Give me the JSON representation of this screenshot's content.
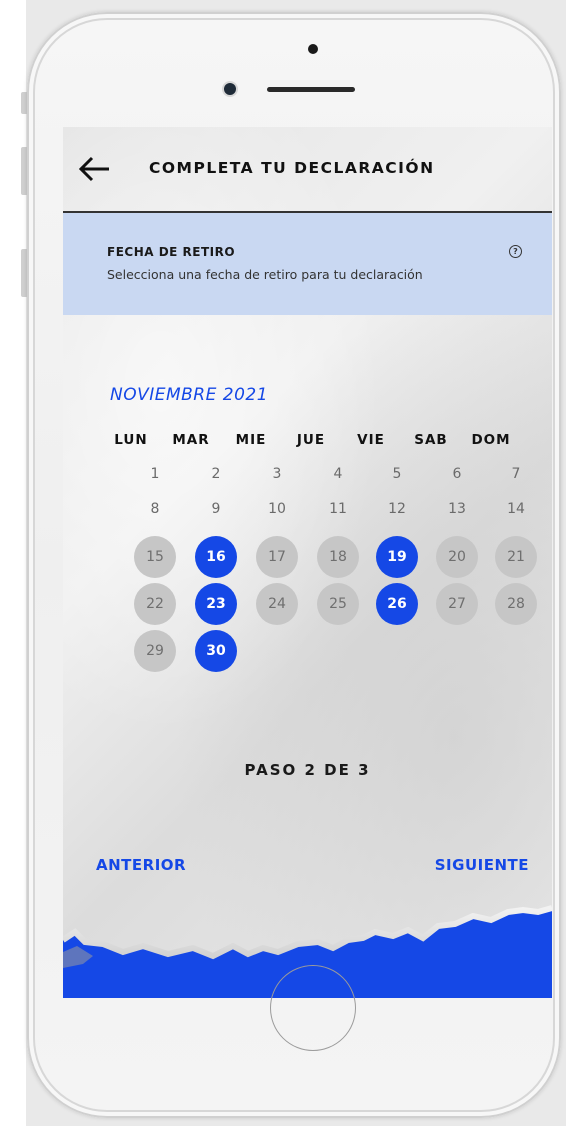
{
  "header": {
    "title": "COMPLETA TU DECLARACIÓN",
    "back_icon": "arrow-left-icon"
  },
  "info": {
    "title": "FECHA DE RETIRO",
    "subtitle": "Selecciona una fecha de retiro para tu declaración",
    "help_glyph": "?"
  },
  "calendar": {
    "month_label": "NOVIEMBRE 2021",
    "weekdays": [
      "LUN",
      "MAR",
      "MIE",
      "JUE",
      "VIE",
      "SAB",
      "DOM"
    ],
    "days": [
      {
        "num": "1",
        "state": "plain"
      },
      {
        "num": "2",
        "state": "plain"
      },
      {
        "num": "3",
        "state": "plain"
      },
      {
        "num": "4",
        "state": "plain"
      },
      {
        "num": "5",
        "state": "plain"
      },
      {
        "num": "6",
        "state": "plain"
      },
      {
        "num": "7",
        "state": "plain"
      },
      {
        "num": "8",
        "state": "plain"
      },
      {
        "num": "9",
        "state": "plain"
      },
      {
        "num": "10",
        "state": "plain"
      },
      {
        "num": "11",
        "state": "plain"
      },
      {
        "num": "12",
        "state": "plain"
      },
      {
        "num": "13",
        "state": "plain"
      },
      {
        "num": "14",
        "state": "plain"
      },
      {
        "num": "15",
        "state": "unavailable"
      },
      {
        "num": "16",
        "state": "available"
      },
      {
        "num": "17",
        "state": "unavailable"
      },
      {
        "num": "18",
        "state": "unavailable"
      },
      {
        "num": "19",
        "state": "available"
      },
      {
        "num": "20",
        "state": "unavailable"
      },
      {
        "num": "21",
        "state": "unavailable"
      },
      {
        "num": "22",
        "state": "unavailable"
      },
      {
        "num": "23",
        "state": "available"
      },
      {
        "num": "24",
        "state": "unavailable"
      },
      {
        "num": "25",
        "state": "unavailable"
      },
      {
        "num": "26",
        "state": "available"
      },
      {
        "num": "27",
        "state": "unavailable"
      },
      {
        "num": "28",
        "state": "unavailable"
      },
      {
        "num": "29",
        "state": "unavailable"
      },
      {
        "num": "30",
        "state": "available"
      }
    ]
  },
  "step": {
    "label": "PASO 2 DE 3"
  },
  "nav": {
    "prev_label": "ANTERIOR",
    "next_label": "SIGUIENTE"
  },
  "colors": {
    "accent": "#1548e6",
    "banner": "#c9d8f2",
    "unavailable": "#c6c6c6"
  }
}
